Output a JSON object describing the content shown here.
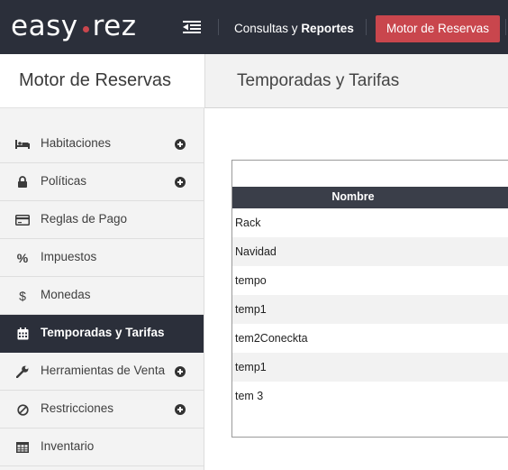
{
  "app": {
    "logo_left": "easy",
    "logo_right": "rez",
    "logo_dot_color": "#c9464d"
  },
  "topnav": {
    "consultas_prefix": "Consultas y",
    "consultas_bold": "Reportes",
    "active_label": "Motor de Reservas"
  },
  "sidebar": {
    "title": "Motor de Reservas",
    "items": [
      {
        "label": "Habitaciones",
        "icon": "bed-icon",
        "expandable": true
      },
      {
        "label": "Políticas",
        "icon": "lock-icon",
        "expandable": true
      },
      {
        "label": "Reglas de Pago",
        "icon": "credit-card-icon",
        "expandable": false
      },
      {
        "label": "Impuestos",
        "icon": "percent-icon",
        "expandable": false
      },
      {
        "label": "Monedas",
        "icon": "dollar-icon",
        "expandable": false
      },
      {
        "label": "Temporadas y Tarifas",
        "icon": "calendar-icon",
        "expandable": false,
        "active": true
      },
      {
        "label": "Herramientas de Venta",
        "icon": "wrench-icon",
        "expandable": true
      },
      {
        "label": "Restricciones",
        "icon": "ban-icon",
        "expandable": true
      },
      {
        "label": "Inventario",
        "icon": "table-icon",
        "expandable": false
      }
    ]
  },
  "main": {
    "title": "Temporadas y Tarifas",
    "table": {
      "columns": [
        "Nombre"
      ],
      "rows": [
        "Rack",
        "Navidad",
        "tempo",
        "temp1",
        "tem2Coneckta",
        "temp1",
        "tem 3"
      ]
    }
  },
  "colors": {
    "topbar": "#2b2f3a",
    "accent": "#c9464d",
    "table_header": "#3a3e49"
  }
}
